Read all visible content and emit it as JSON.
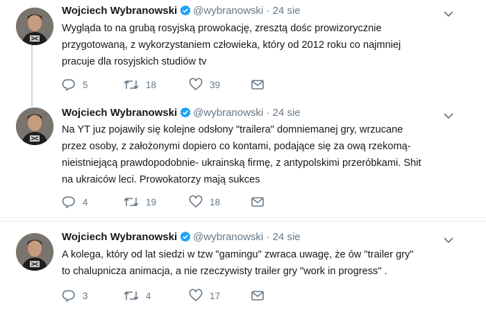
{
  "tweets": [
    {
      "name": "Wojciech Wybranowski",
      "handle": "@wybranowski",
      "separator": "·",
      "time": "24 sie",
      "lines": [
        "Wygląda to na grubą rosyjską prowokację, zresztą dośc prowizorycznie",
        "przygotowaną, z wykorzystaniem człowieka, który od 2012 roku co najmniej",
        "pracuje dla rosyjskich studiów tv"
      ],
      "replies": "5",
      "retweets": "18",
      "likes": "39"
    },
    {
      "name": "Wojciech Wybranowski",
      "handle": "@wybranowski",
      "separator": "·",
      "time": "24 sie",
      "lines": [
        "Na YT juz pojawily się kolejne odsłony \"trailera\" domniemanej gry, wrzucane",
        "przez osoby, z założonymi dopiero co kontami, podające się za ową rzekomą-",
        "nieistniejącą prawdopodobnie- ukrainską firmę, z antypolskimi przeróbkami. Shit",
        "na ukraiców leci. Prowokatorzy mają sukces"
      ],
      "replies": "4",
      "retweets": "19",
      "likes": "18"
    },
    {
      "name": "Wojciech Wybranowski",
      "handle": "@wybranowski",
      "separator": "·",
      "time": "24 sie",
      "lines": [
        "A kolega, który od lat siedzi w tzw \"gamingu\" zwraca uwagę, że ów \"trailer gry\"",
        "to chalupnicza animacja, a nie rzeczywisty trailer gry \"work in progress\" ."
      ],
      "replies": "3",
      "retweets": "4",
      "likes": "17"
    }
  ],
  "icons": {
    "verified": "verified-badge-icon",
    "caret": "chevron-down-icon",
    "reply": "reply-icon",
    "retweet": "retweet-icon",
    "like": "heart-icon",
    "dm": "envelope-icon"
  },
  "colors": {
    "verified": "#1da1f2",
    "muted": "#657786",
    "thread_line": "#c4d7e6",
    "divider": "#e6ecf0"
  }
}
